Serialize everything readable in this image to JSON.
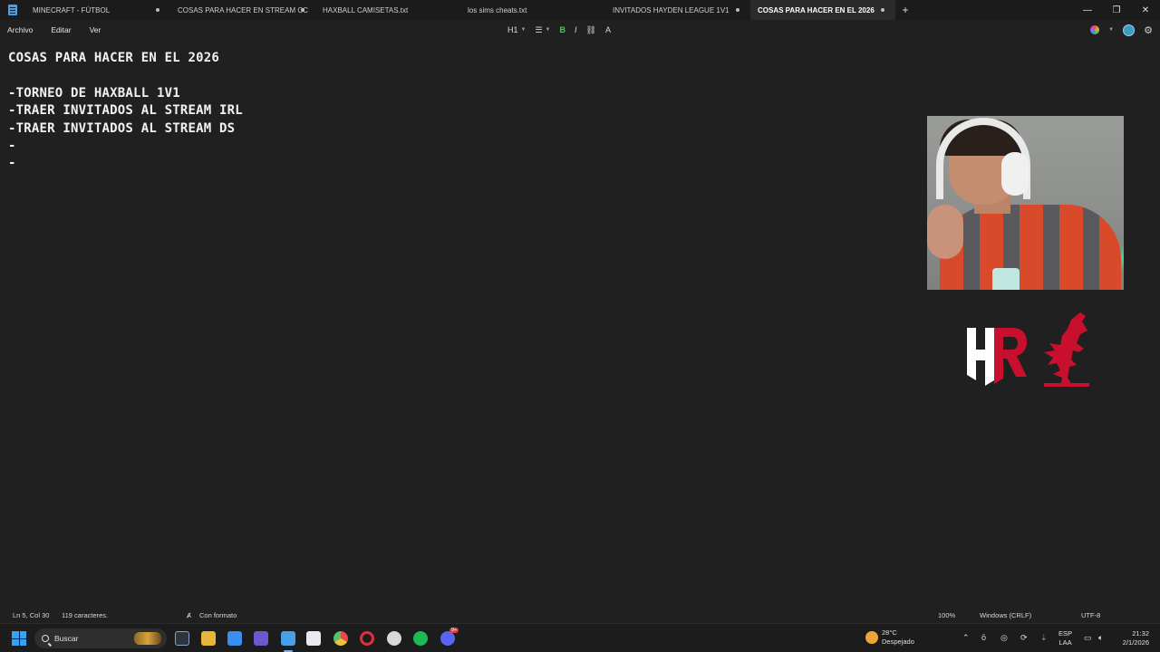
{
  "tabs": [
    {
      "label": "MINECRAFT - FÚTBOL",
      "modified": true,
      "active": false
    },
    {
      "label": "COSAS PARA HACER EN STREAM CC",
      "modified": true,
      "active": false
    },
    {
      "label": "HAXBALL CAMISETAS.txt",
      "modified": false,
      "active": false
    },
    {
      "label": "los sims cheats.txt",
      "modified": false,
      "active": false
    },
    {
      "label": "INVITADOS HAYDEN LEAGUE 1V1",
      "modified": true,
      "active": false
    },
    {
      "label": "COSAS PARA HACER EN EL 2026",
      "modified": true,
      "active": true
    }
  ],
  "tab_add": "+",
  "window_controls": {
    "minimize": "—",
    "maximize": "❐",
    "close": "✕"
  },
  "menu": {
    "file": "Archivo",
    "edit": "Editar",
    "view": "Ver"
  },
  "format_toolbar": {
    "heading": "H1",
    "list": "☰",
    "bold": "B",
    "italic": "I",
    "link": "⛓",
    "clear": "A"
  },
  "editor": {
    "lines": [
      "COSAS PARA HACER EN EL 2026",
      "",
      "-TORNEO DE HAXBALL 1V1",
      "-TRAER INVITADOS AL STREAM IRL",
      "-TRAER INVITADOS AL STREAM DS",
      "-",
      "-"
    ]
  },
  "logos": {
    "hr_letters": "HR"
  },
  "status": {
    "position": "Ln 5, Col 30",
    "chars": "119 caracteres.",
    "format": "Con formato",
    "zoom": "100%",
    "line_ending": "Windows (CRLF)",
    "encoding": "UTF-8"
  },
  "taskbar": {
    "search_label": "Buscar",
    "weather_temp": "28°C",
    "weather_desc": "Despejado",
    "lang_top": "ESP",
    "lang_bottom": "LAA",
    "time": "21:32",
    "date": "2/1/2026",
    "discord_badge": "9+"
  },
  "colors": {
    "accent": "#5bc06b",
    "background": "#202020",
    "titlebar": "#1b1b1b",
    "active_tab": "#2b2b2b",
    "lfc_red": "#c8102e"
  }
}
